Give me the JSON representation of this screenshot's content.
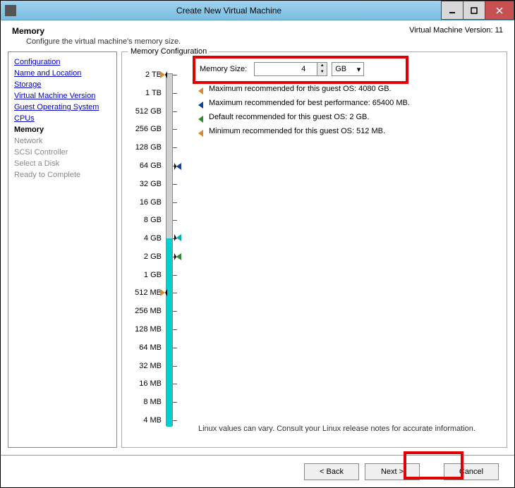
{
  "window": {
    "title": "Create New Virtual Machine",
    "version_label": "Virtual Machine Version: 11"
  },
  "header": {
    "title": "Memory",
    "subtitle": "Configure the virtual machine's memory size."
  },
  "sidebar": {
    "links": [
      "Configuration",
      "Name and Location",
      "Storage",
      "Virtual Machine Version",
      "Guest Operating System",
      "CPUs"
    ],
    "current": "Memory",
    "future": [
      "Network",
      "SCSI Controller",
      "Select a Disk",
      "Ready to Complete"
    ]
  },
  "memconfig": {
    "legend": "Memory Configuration",
    "size_label": "Memory Size:",
    "size_value": "4",
    "unit": "GB",
    "ticks": [
      "2 TB",
      "1 TB",
      "512 GB",
      "256 GB",
      "128 GB",
      "64 GB",
      "32 GB",
      "16 GB",
      "8 GB",
      "4 GB",
      "2 GB",
      "1 GB",
      "512 MB",
      "256 MB",
      "128 MB",
      "64 MB",
      "32 MB",
      "16 MB",
      "8 MB",
      "4 MB"
    ],
    "notes": {
      "max_guest": "Maximum recommended for this guest OS: 4080 GB.",
      "max_perf": "Maximum recommended for best performance: 65400 MB.",
      "default": "Default recommended for this guest OS: 2 GB.",
      "min": "Minimum recommended for this guest OS: 512 MB."
    },
    "footnote": "Linux values can vary. Consult your Linux release notes for accurate information."
  },
  "buttons": {
    "back": "< Back",
    "next": "Next >",
    "cancel": "Cancel"
  },
  "colors": {
    "marker_orange": "#d98b2b",
    "marker_blue": "#1040a0",
    "marker_green": "#2e8b2e"
  }
}
